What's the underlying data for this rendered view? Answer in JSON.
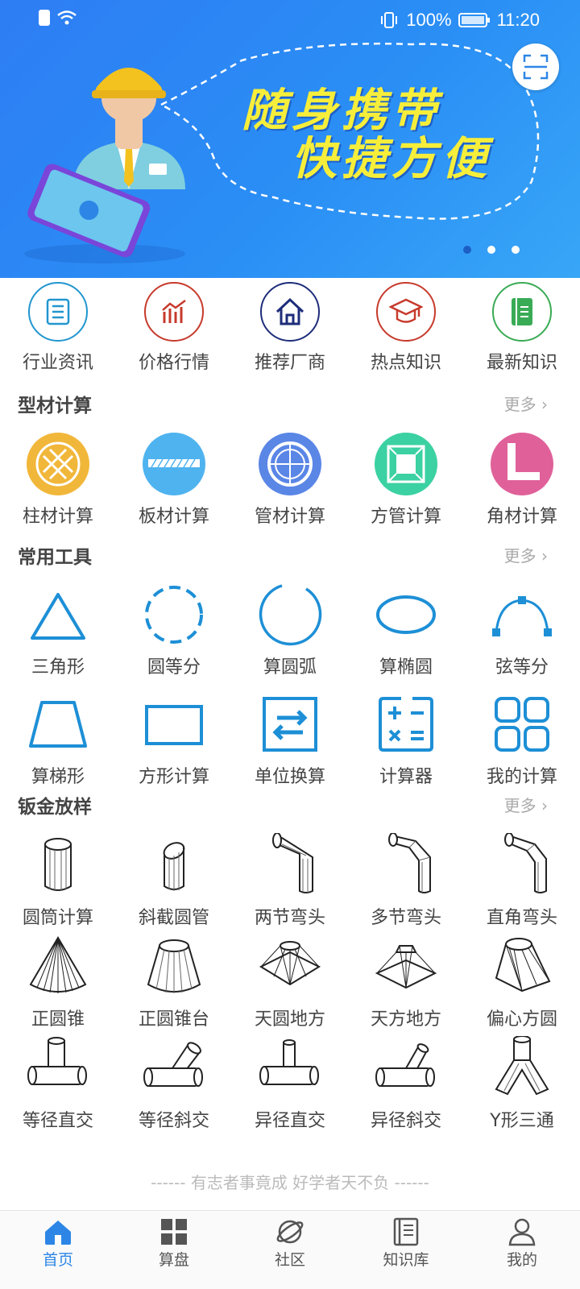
{
  "status": {
    "battery": "100%",
    "time": "11:20"
  },
  "banner": {
    "line1": "随身携带",
    "line2": "快捷方便",
    "pages": 3,
    "active_page": 1
  },
  "quick": [
    {
      "label": "行业资讯",
      "icon": "news-icon",
      "color": "#2196cf"
    },
    {
      "label": "价格行情",
      "icon": "price-chart-icon",
      "color": "#c73a2c"
    },
    {
      "label": "推荐厂商",
      "icon": "house-icon",
      "color": "#1e2d7a"
    },
    {
      "label": "热点知识",
      "icon": "graduation-cap-icon",
      "color": "#c73a2c"
    },
    {
      "label": "最新知识",
      "icon": "book-icon",
      "color": "#3aab55"
    }
  ],
  "sections": {
    "profile": {
      "title": "型材计算",
      "more": "更多"
    },
    "tools": {
      "title": "常用工具",
      "more": "更多"
    },
    "sheet": {
      "title": "钣金放样",
      "more": "更多"
    }
  },
  "profile_items": [
    {
      "label": "柱材计算",
      "icon": "column-icon",
      "color": "#f1b73a"
    },
    {
      "label": "板材计算",
      "icon": "plate-icon",
      "color": "#4fb3ef"
    },
    {
      "label": "管材计算",
      "icon": "pipe-icon",
      "color": "#5a86e6"
    },
    {
      "label": "方管计算",
      "icon": "square-tube-icon",
      "color": "#3bd1a2"
    },
    {
      "label": "角材计算",
      "icon": "angle-steel-icon",
      "color": "#e0619a"
    }
  ],
  "tool_items": [
    {
      "label": "三角形",
      "icon": "triangle-icon"
    },
    {
      "label": "圆等分",
      "icon": "dashed-circle-icon"
    },
    {
      "label": "算圆弧",
      "icon": "arc-icon"
    },
    {
      "label": "算椭圆",
      "icon": "ellipse-icon"
    },
    {
      "label": "弦等分",
      "icon": "chord-icon"
    },
    {
      "label": "算梯形",
      "icon": "trapezoid-icon"
    },
    {
      "label": "方形计算",
      "icon": "rectangle-icon"
    },
    {
      "label": "单位换算",
      "icon": "swap-icon"
    },
    {
      "label": "计算器",
      "icon": "calculator-icon"
    },
    {
      "label": "我的计算",
      "icon": "grid-icon"
    }
  ],
  "sheet_items": [
    {
      "label": "圆筒计算",
      "icon": "cylinder-icon"
    },
    {
      "label": "斜截圆管",
      "icon": "oblique-pipe-icon"
    },
    {
      "label": "两节弯头",
      "icon": "two-section-elbow-icon"
    },
    {
      "label": "多节弯头",
      "icon": "multi-section-elbow-icon"
    },
    {
      "label": "直角弯头",
      "icon": "right-angle-elbow-icon"
    },
    {
      "label": "正圆锥",
      "icon": "cone-icon"
    },
    {
      "label": "正圆锥台",
      "icon": "frustum-icon"
    },
    {
      "label": "天圆地方",
      "icon": "round-to-square-icon"
    },
    {
      "label": "天方地方",
      "icon": "square-to-square-icon"
    },
    {
      "label": "偏心方圆",
      "icon": "eccentric-transition-icon"
    },
    {
      "label": "等径直交",
      "icon": "equal-tee-icon"
    },
    {
      "label": "等径斜交",
      "icon": "equal-oblique-tee-icon"
    },
    {
      "label": "异径直交",
      "icon": "reducing-tee-icon"
    },
    {
      "label": "异径斜交",
      "icon": "reducing-oblique-tee-icon"
    },
    {
      "label": "Y形三通",
      "icon": "y-tee-icon"
    }
  ],
  "footer_note": "------ 有志者事竟成 好学者天不负 ------",
  "tabs": [
    {
      "label": "首页",
      "icon": "home-icon",
      "active": true
    },
    {
      "label": "算盘",
      "icon": "abacus-grid-icon",
      "active": false
    },
    {
      "label": "社区",
      "icon": "community-planet-icon",
      "active": false
    },
    {
      "label": "知识库",
      "icon": "knowledge-book-icon",
      "active": false
    },
    {
      "label": "我的",
      "icon": "profile-icon",
      "active": false
    }
  ],
  "colors": {
    "accent": "#2d86e6",
    "tool_blue": "#1d8fd6",
    "banner": "#2e7df3"
  }
}
